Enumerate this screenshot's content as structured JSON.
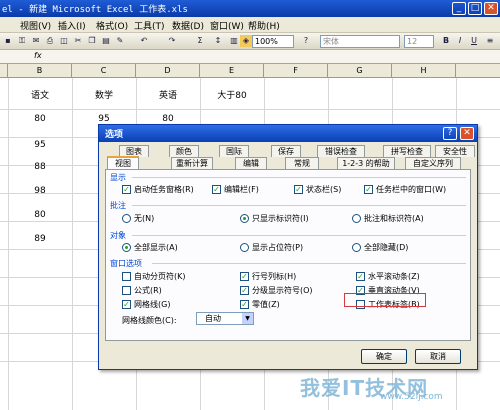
{
  "window": {
    "title": "el - 新建 Microsoft Excel 工作表.xls"
  },
  "menu": [
    "视图(V)",
    "插入(I)",
    "格式(O)",
    "工具(T)",
    "数据(D)",
    "窗口(W)",
    "帮助(H)"
  ],
  "toolbar": {
    "zoom": "100%",
    "font": "宋体",
    "fontsize": "12"
  },
  "formula_bar": {
    "fx": "fx"
  },
  "columns": [
    "B",
    "C",
    "D",
    "E",
    "F",
    "G",
    "H"
  ],
  "sheet": {
    "headers": [
      "语文",
      "数学",
      "英语",
      "大于80"
    ],
    "col_b": [
      "80",
      "95",
      "88",
      "98",
      "80",
      "89"
    ],
    "col_c_row1": "95",
    "col_d_row1": "80"
  },
  "dialog": {
    "title": "选项",
    "help_btn": "?",
    "close_btn": "✕",
    "tabs_row1": [
      "图表",
      "颜色",
      "国际",
      "保存",
      "错误检查",
      "拼写检查",
      "安全性"
    ],
    "tabs_row2": [
      "视图",
      "重新计算",
      "编辑",
      "常规",
      "1-2-3 的帮助",
      "自定义序列"
    ],
    "active_tab": "视图",
    "sections": {
      "show": "显示",
      "comments": "批注",
      "objects": "对象",
      "window_options": "窗口选项"
    },
    "show_opts": [
      {
        "label": "启动任务窗格(R)",
        "checked": true
      },
      {
        "label": "编辑栏(F)",
        "checked": true
      },
      {
        "label": "状态栏(S)",
        "checked": true
      },
      {
        "label": "任务栏中的窗口(W)",
        "checked": true
      }
    ],
    "comment_opts": [
      {
        "label": "无(N)",
        "selected": false
      },
      {
        "label": "只显示标识符(I)",
        "selected": true
      },
      {
        "label": "批注和标识符(A)",
        "selected": false
      }
    ],
    "object_opts": [
      {
        "label": "全部显示(A)",
        "selected": true
      },
      {
        "label": "显示占位符(P)",
        "selected": false
      },
      {
        "label": "全部隐藏(D)",
        "selected": false
      }
    ],
    "window_opts": [
      {
        "label": "自动分页符(K)",
        "checked": false
      },
      {
        "label": "行号列标(H)",
        "checked": true
      },
      {
        "label": "水平滚动条(Z)",
        "checked": true
      },
      {
        "label": "公式(R)",
        "checked": false
      },
      {
        "label": "分级显示符号(O)",
        "checked": true
      },
      {
        "label": "垂直滚动条(V)",
        "checked": true
      },
      {
        "label": "网格线(G)",
        "checked": true
      },
      {
        "label": "零值(Z)",
        "checked": true
      },
      {
        "label": "工作表标签(B)",
        "checked": false
      }
    ],
    "grid_color_label": "网格线颜色(C):",
    "grid_color_value": "自动",
    "ok": "确定",
    "cancel": "取消"
  },
  "watermark": {
    "text": "我爱IT技术网",
    "url": "www.52ij.com"
  },
  "colors": {
    "titlebar": "#0b3aa8",
    "dialog_bg": "#ece9d8",
    "highlight": "#d23b3b"
  }
}
